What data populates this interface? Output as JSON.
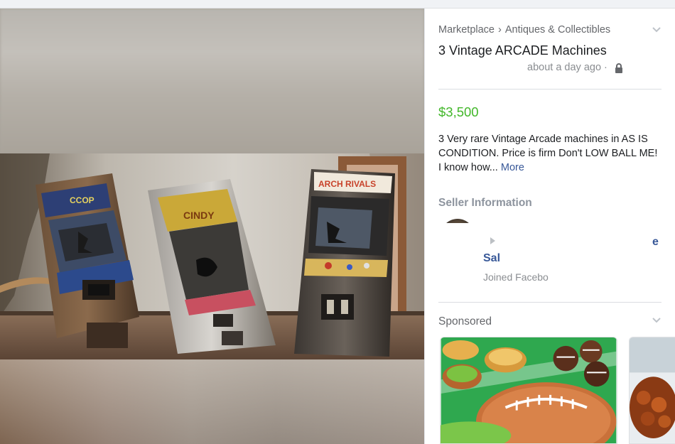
{
  "listing": {
    "breadcrumb": {
      "root": "Marketplace",
      "separator": "›",
      "category": "Antiques & Collectibles"
    },
    "title": "3 Vintage ARCADE Machines",
    "posted": "about a day ago ·",
    "price": "$3,500",
    "description": "3 Very rare Vintage Arcade machines in AS IS CONDITION. Price is firm Don't LOW BALL ME! I know how...",
    "more_label": "More"
  },
  "seller": {
    "heading": "Seller Information",
    "name_partial": "Sal",
    "name_tail": "e",
    "joined_partial": "Joined Facebo"
  },
  "sponsored": {
    "heading": "Sponsored"
  },
  "photo": {
    "cabinet_marquees": [
      "CCOP",
      "CINDY",
      "ARCH RIVALS"
    ]
  },
  "icons": {
    "lock": "lock-icon",
    "chevron": "chevron-down-icon",
    "play": "play-icon"
  },
  "colors": {
    "price": "#42b72a",
    "link": "#385898",
    "muted": "#65676b"
  }
}
